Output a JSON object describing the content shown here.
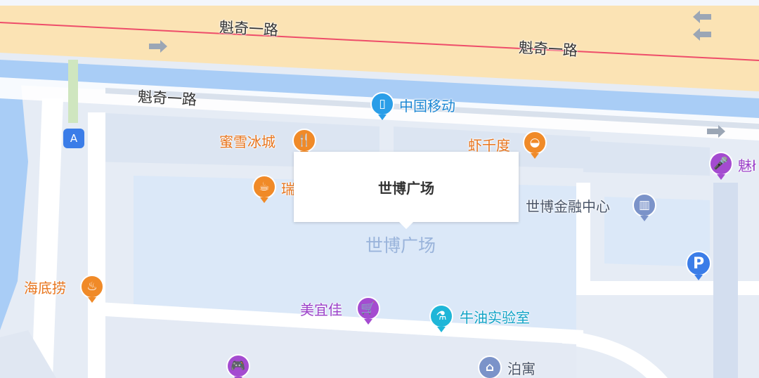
{
  "roads": {
    "main_top_1": "魁奇一路",
    "main_top_2": "魁奇一路",
    "service": "魁奇一路"
  },
  "callout": {
    "title": "世博广场"
  },
  "area_label": "世博广场",
  "station": {
    "letter": "A",
    "icon": "metro-exit-icon"
  },
  "parking": {
    "letter": "P",
    "icon": "parking-icon"
  },
  "pois": [
    {
      "name": "中国移动",
      "icon": "mobile-phone-icon",
      "color": "#2a9ee8"
    },
    {
      "name": "蜜雪冰城",
      "icon": "restaurant-icon",
      "color": "#f08a28"
    },
    {
      "name": "虾千度",
      "icon": "noodle-bowl-icon",
      "color": "#f08a28"
    },
    {
      "name": "瑞",
      "icon": "coffee-cup-icon",
      "color": "#f08a28"
    },
    {
      "name": "世博金融中心",
      "icon": "office-building-icon",
      "color": "#7b93c9"
    },
    {
      "name": "魅ł",
      "icon": "karaoke-mic-icon",
      "color": "#a44bd0"
    },
    {
      "name": "海底捞",
      "icon": "hotpot-icon",
      "color": "#f08a28"
    },
    {
      "name": "美宜佳",
      "icon": "shopping-cart-icon",
      "color": "#a44bd0"
    },
    {
      "name": "牛油实验室",
      "icon": "flask-icon",
      "color": "#1fb6d8"
    },
    {
      "name": "泊寓",
      "icon": "apartment-icon",
      "color": "#7b93c9"
    },
    {
      "name": "",
      "icon": "game-controller-icon",
      "color": "#a44bd0"
    }
  ],
  "colors": {
    "main_road": "#fbe3b4",
    "road_center_line": "#ee4d6a",
    "water": "#a9cdf6",
    "block": "#dde6f3",
    "plaza": "#dbe8f8"
  }
}
